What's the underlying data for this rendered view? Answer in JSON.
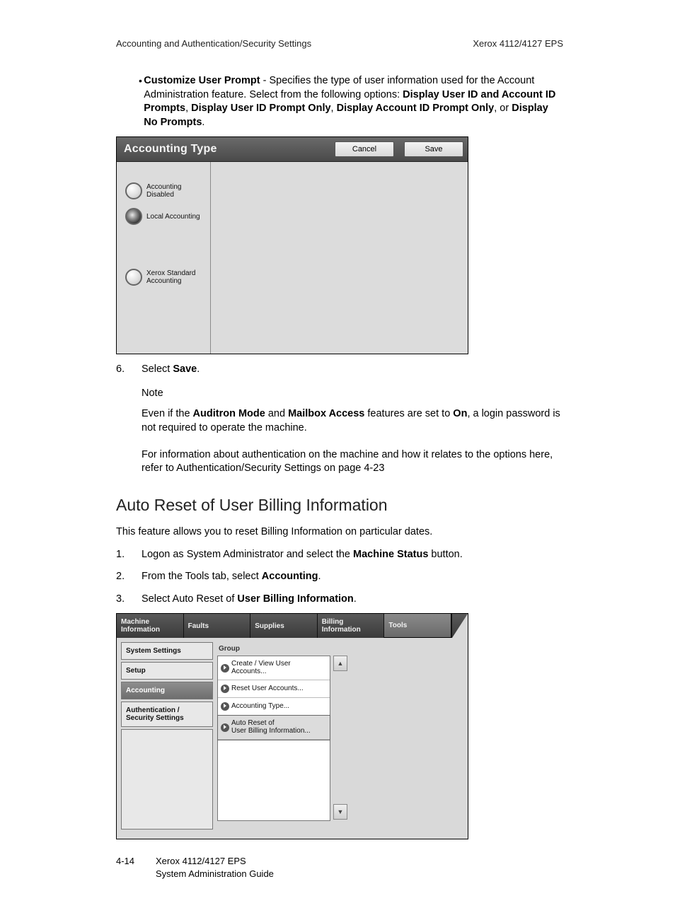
{
  "header": {
    "left": "Accounting and Authentication/Security Settings",
    "right": "Xerox 4112/4127 EPS"
  },
  "bullet": {
    "lead_bold": "Customize User Prompt",
    "lead_rest": " - Specifies the type of user information used for the Account Administration feature. Select from the following options: ",
    "opt1": "Display User ID and Account ID Prompts",
    "sep1": ", ",
    "opt2": "Display User ID Prompt Only",
    "sep2": ", ",
    "opt3": "Display Account ID Prompt Only",
    "sep3": ", or ",
    "opt4": "Display No Prompts",
    "end": "."
  },
  "ss1": {
    "title": "Accounting Type",
    "cancel": "Cancel",
    "save": "Save",
    "radios": [
      {
        "label_l1": "Accounting",
        "label_l2": "Disabled",
        "selected": false
      },
      {
        "label_l1": "Local Accounting",
        "label_l2": "",
        "selected": true
      },
      {
        "label_l1": "Xerox Standard",
        "label_l2": "Accounting",
        "selected": false
      }
    ]
  },
  "step6": {
    "num": "6.",
    "pre": "Select ",
    "bold": "Save",
    "post": "."
  },
  "note": {
    "title": "Note",
    "p1_pre": "Even if the ",
    "p1_b1": "Auditron Mode",
    "p1_mid1": " and ",
    "p1_b2": "Mailbox Access",
    "p1_mid2": " features are set to ",
    "p1_b3": "On",
    "p1_post": ", a login password is not required to operate the machine.",
    "p2": "For information about authentication on the machine and how it relates to the options here, refer to Authentication/Security Settings on page 4-23"
  },
  "heading": "Auto Reset of User Billing Information",
  "intro": "This feature allows you to reset Billing Information on particular dates.",
  "steps": [
    {
      "num": "1.",
      "pre": "Logon as System Administrator and select the ",
      "bold": "Machine Status",
      "post": " button."
    },
    {
      "num": "2.",
      "pre": "From the Tools tab, select ",
      "bold": "Accounting",
      "post": "."
    },
    {
      "num": "3.",
      "pre": "Select Auto Reset of ",
      "bold": "User Billing Information",
      "post": "."
    }
  ],
  "ss2": {
    "tabs": [
      "Machine\nInformation",
      "Faults",
      "Supplies",
      "Billing\nInformation",
      "Tools"
    ],
    "active_tab_index": 4,
    "sidebar": [
      {
        "label": "System Settings",
        "selected": false
      },
      {
        "label": "Setup",
        "selected": false
      },
      {
        "label": "Accounting",
        "selected": true
      },
      {
        "label": "Authentication /\nSecurity Settings",
        "selected": false
      }
    ],
    "group_label": "Group",
    "items": [
      {
        "label": "Create / View User Accounts...",
        "selected": false
      },
      {
        "label": "Reset User Accounts...",
        "selected": false
      },
      {
        "label": "Accounting Type...",
        "selected": false
      },
      {
        "label": "Auto Reset of\nUser Billing Information...",
        "selected": true
      }
    ]
  },
  "footer": {
    "pagenum": "4-14",
    "l1": "Xerox 4112/4127 EPS",
    "l2": "System Administration Guide"
  }
}
